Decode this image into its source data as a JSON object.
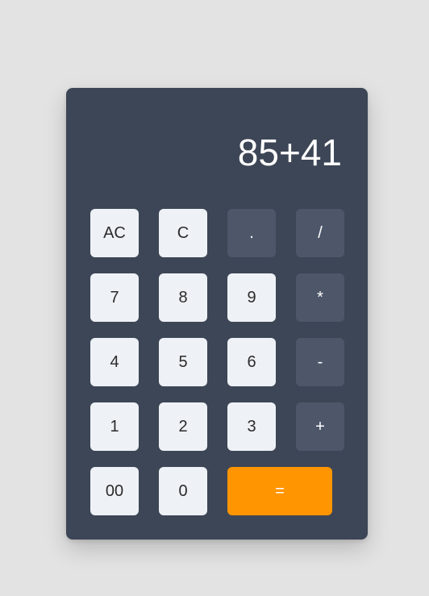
{
  "display": {
    "expression": "85+41"
  },
  "keys": {
    "ac": "AC",
    "c": "C",
    "dot": ".",
    "divide": "/",
    "seven": "7",
    "eight": "8",
    "nine": "9",
    "multiply": "*",
    "four": "4",
    "five": "5",
    "six": "6",
    "minus": "-",
    "one": "1",
    "two": "2",
    "three": "3",
    "plus": "+",
    "double_zero": "00",
    "zero": "0",
    "equals": "="
  },
  "colors": {
    "background": "#e3e3e3",
    "body": "#3d4656",
    "number_key": "#eef1f6",
    "operator_key": "#4d5769",
    "equals_key": "#ff9500"
  }
}
